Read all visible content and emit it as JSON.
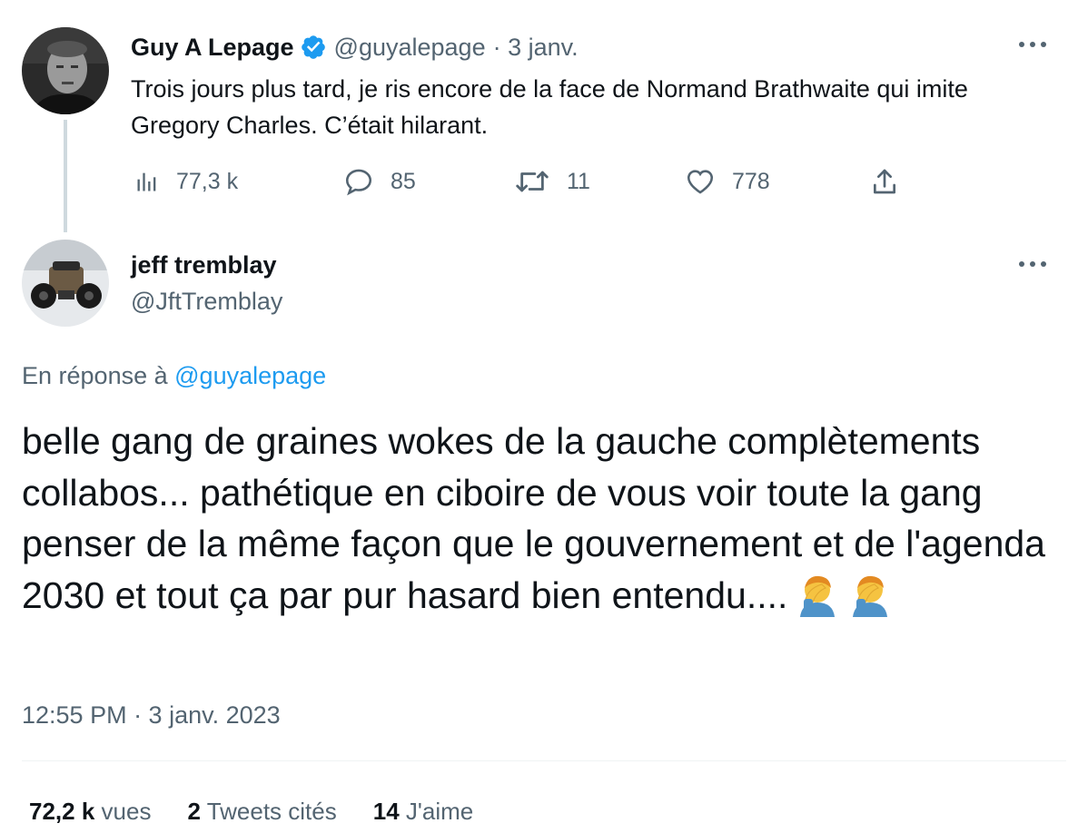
{
  "parent": {
    "name": "Guy A Lepage",
    "handle": "@guyalepage",
    "date": "· 3 janv.",
    "text": "Trois jours plus tard, je ris encore de la face de Normand Brathwaite qui imite Gregory Charles. C’était hilarant.",
    "views": "77,3 k",
    "replies": "85",
    "retweets": "11",
    "likes": "778"
  },
  "reply": {
    "name": "jeff tremblay",
    "handle": "@JftTremblay",
    "reply_prefix": "En réponse à",
    "reply_to": "@guyalepage",
    "text": "belle gang de graines wokes de la gauche complètements collabos... pathétique en ciboire de vous voir toute la gang penser de la même façon que le gouvernement et de l'agenda 2030 et tout ça par pur hasard bien entendu....",
    "timestamp": "12:55 PM · 3 janv. 2023"
  },
  "stats": {
    "views_value": "72,2 k",
    "views_label": "vues",
    "quotes_value": "2",
    "quotes_label": "Tweets cités",
    "likes_value": "14",
    "likes_label": "J'aime"
  },
  "colors": {
    "text": "#0f1419",
    "muted": "#536471",
    "link": "#1d9bf0",
    "line": "#cfd9de"
  },
  "icons": [
    "verified-badge-icon",
    "more-icon",
    "views-icon",
    "reply-icon",
    "retweet-icon",
    "like-icon",
    "share-icon",
    "facepalm-emoji"
  ]
}
